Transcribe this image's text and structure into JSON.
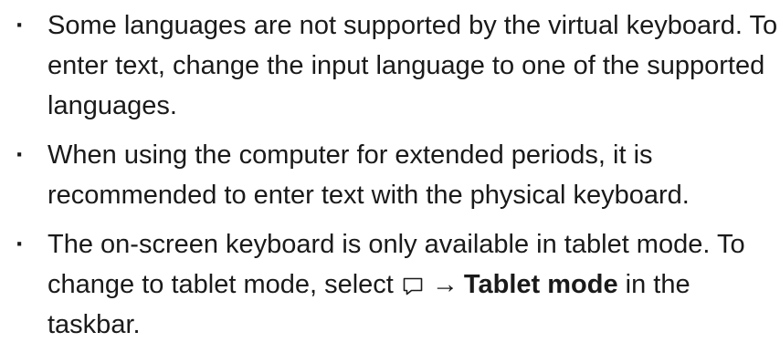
{
  "bullet_glyph": "·",
  "notes": [
    {
      "text": "Some languages are not supported by the virtual keyboard. To enter text, change the input language to one of the supported languages."
    },
    {
      "text": "When using the computer for extended periods, it is recommended to enter text with the physical keyboard."
    },
    {
      "before": "The on-screen keyboard is only available in tablet mode. To change to tablet mode, select",
      "icon": "action-center-icon",
      "arrow": "→",
      "bold": "Tablet mode",
      "after": "in the taskbar."
    }
  ]
}
